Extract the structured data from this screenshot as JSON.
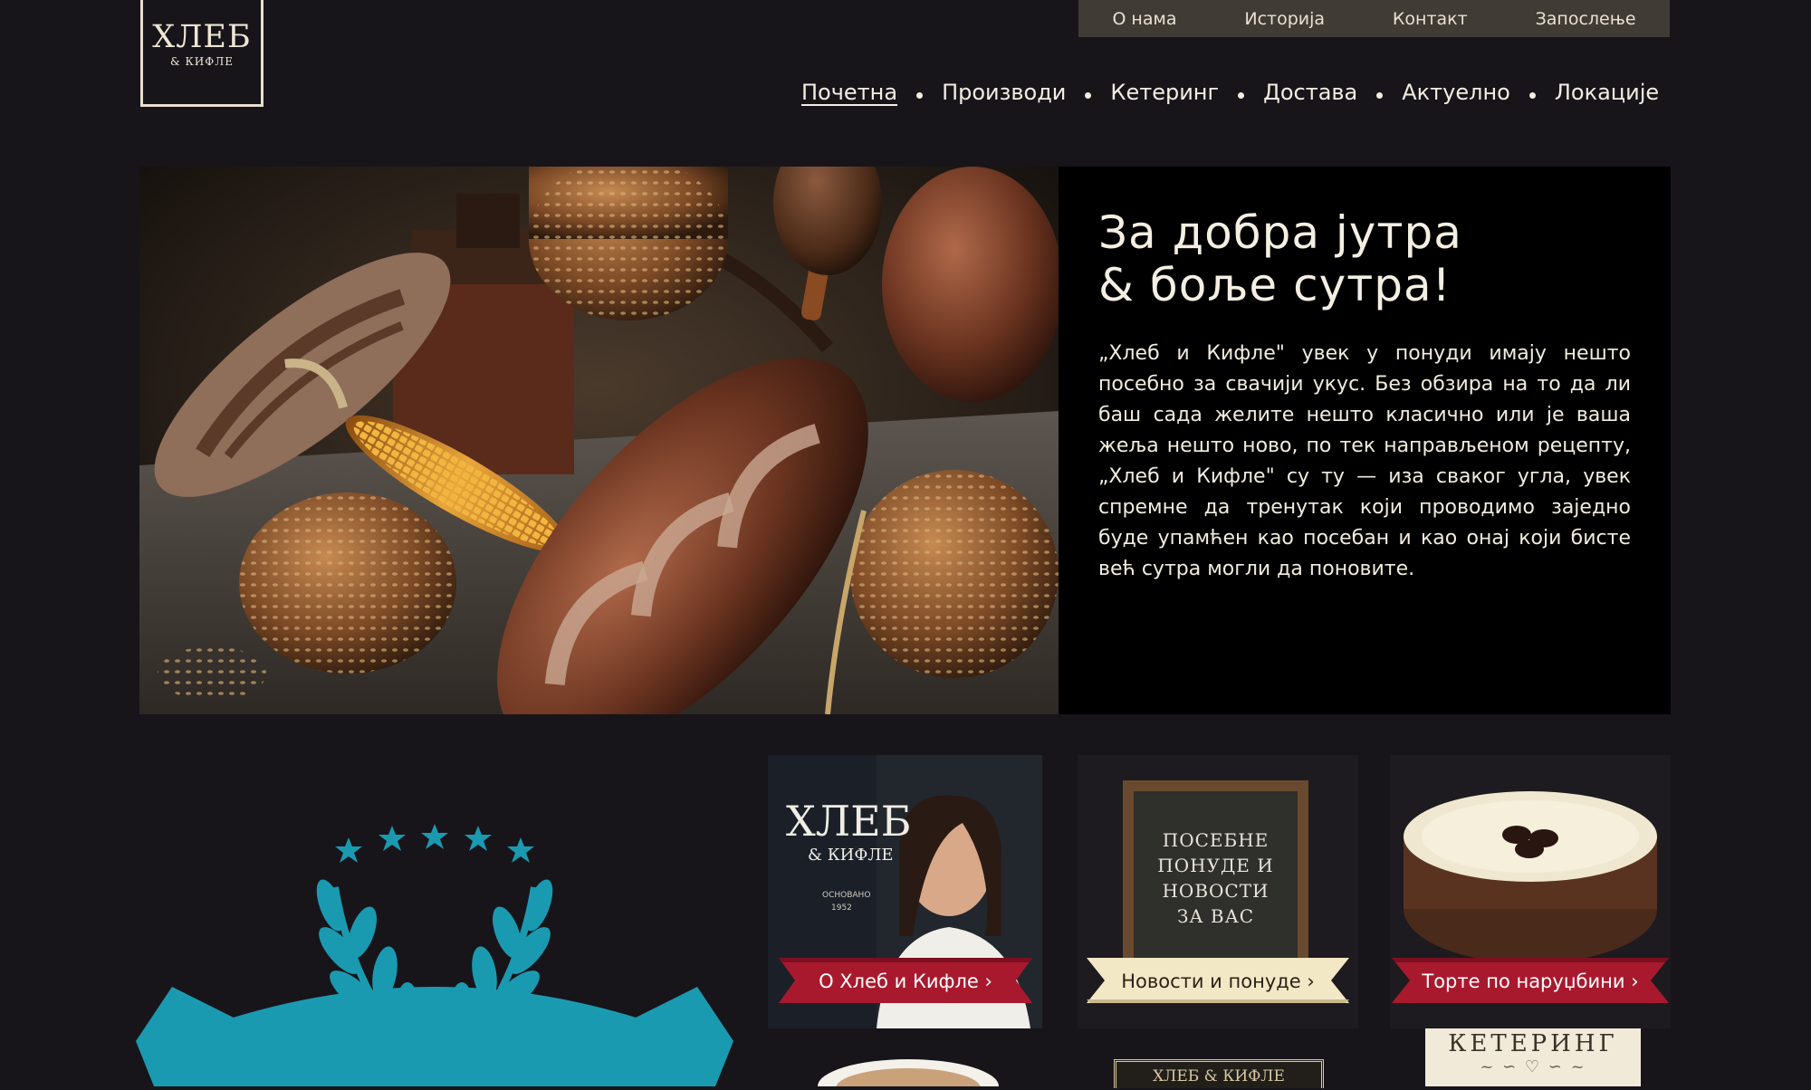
{
  "logo": {
    "main": "ХЛЕБ",
    "sub": "& КИФЛЕ"
  },
  "topbar": {
    "items": [
      "О нама",
      "Историја",
      "Контакт",
      "Запослење"
    ]
  },
  "nav": {
    "items": [
      "Почетна",
      "Производи",
      "Кетеринг",
      "Достава",
      "Актуелно",
      "Локације"
    ]
  },
  "hero": {
    "title_line1": "За добра јутра",
    "title_line2": "& боље сутра!",
    "text": "„Хлеб и Кифле\" увек у понуди имају нешто посебно за свачији укус. Без обзира на то да ли баш сада желите нешто класично или је ваша жеља нешто ново, по тек направљеном рецепту, „Хлеб и Кифле\" су ту — иза сваког угла, увек спремне да тренутак који проводимо заједно буде упамћен као посебан и као онај који бисте већ сутра могли да поновите."
  },
  "tiles": {
    "about": {
      "label": "О Хлеб и Кифле ›",
      "sign_main": "ХЛЕБ",
      "sign_sub": "& КИФЛЕ",
      "sign_small1": "ОСНОВАНО",
      "sign_small2": "1952"
    },
    "news": {
      "label": "Новости и понуде ›",
      "board_text": [
        "ПОСЕБНЕ",
        "ПОНУДЕ И",
        "НОВОСТИ",
        "ЗА ВАС"
      ]
    },
    "cakes": {
      "label": "Торте по наруџбини ›"
    }
  },
  "lower_row": {
    "cafe_sign": "ХЛЕБ & КИФЛЕ",
    "catering_sign": "КЕТЕРИНГ"
  },
  "colors": {
    "background": "#17151a",
    "ribbon_red": "#a8192e",
    "ribbon_cream": "#f3e8c6",
    "badge_teal": "#1a9ab1"
  }
}
